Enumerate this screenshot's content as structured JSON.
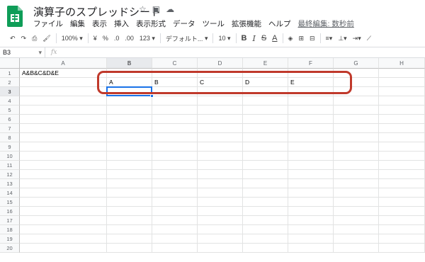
{
  "title": "演算子のスプレッドシート",
  "menu": [
    "ファイル",
    "編集",
    "表示",
    "挿入",
    "表示形式",
    "データ",
    "ツール",
    "拡張機能",
    "ヘルプ"
  ],
  "last_edit": "最終編集: 数秒前",
  "toolbar": {
    "zoom": "100%",
    "currency": "¥",
    "percent": "%",
    "dec_decrease": ".0",
    "dec_increase": ".00",
    "more_formats": "123",
    "font": "デフォルト...",
    "font_size": "10",
    "bold": "B",
    "italic": "I",
    "strike": "S",
    "text_color": "A"
  },
  "namebox": "B3",
  "fx": "fx",
  "columns": [
    "A",
    "B",
    "C",
    "D",
    "E",
    "F",
    "G",
    "H"
  ],
  "rows": [
    "1",
    "2",
    "3",
    "4",
    "5",
    "6",
    "7",
    "8",
    "9",
    "10",
    "11",
    "12",
    "13",
    "14",
    "15",
    "16",
    "17",
    "18",
    "19",
    "20"
  ],
  "cells": {
    "A1": "A&B&C&D&E",
    "B2": "A",
    "C2": "B",
    "D2": "C",
    "E2": "D",
    "F2": "E"
  },
  "colors": {
    "selection": "#1a73e8",
    "annotation": "#c0392b",
    "logo": "#0f9d58"
  }
}
